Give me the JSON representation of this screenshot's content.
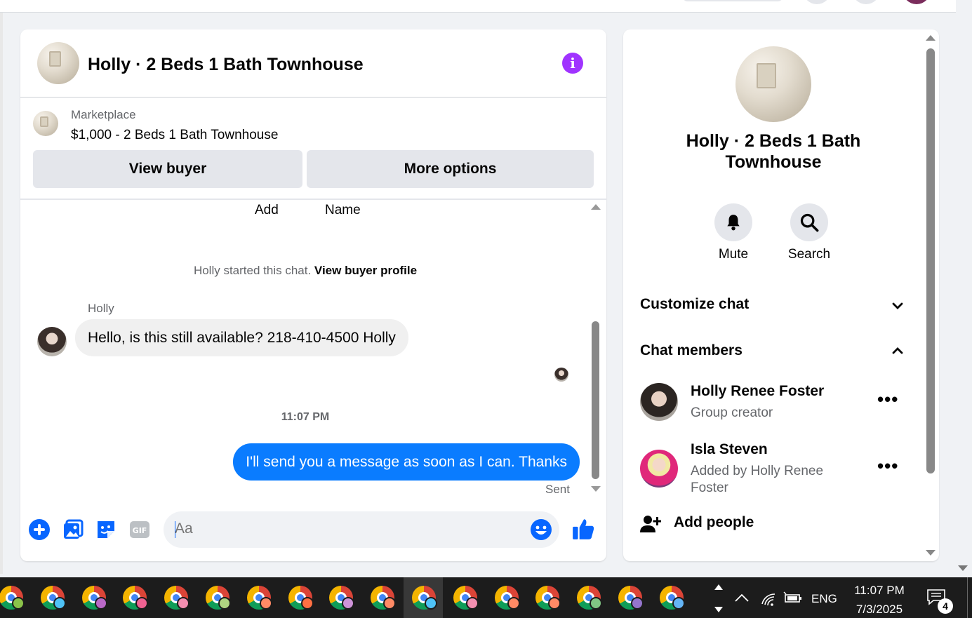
{
  "chat": {
    "title": "Holly · 2 Beds 1 Bath Townhouse",
    "marketplace_label": "Marketplace",
    "listing": "$1,000 - 2 Beds 1 Bath Townhouse",
    "view_buyer": "View buyer",
    "more_options": "More options",
    "add_label": "Add",
    "name_label": "Name",
    "started_text": "Holly started this chat. ",
    "view_profile": "View buyer profile",
    "sender_name": "Holly",
    "incoming_message": "Hello, is this still available? 218-410-4500 Holly",
    "timestamp": "11:07 PM",
    "outgoing_message": "I'll send you a message as soon as I can. Thanks",
    "status": "Sent",
    "composer_placeholder": "Aa",
    "accent_color": "#0a7cff"
  },
  "info": {
    "title": "Holly · 2 Beds 1 Bath Townhouse",
    "mute": "Mute",
    "search": "Search",
    "customize": "Customize chat",
    "members_title": "Chat members",
    "members": [
      {
        "name": "Holly Renee Foster",
        "sub": "Group creator"
      },
      {
        "name": "Isla Steven",
        "sub": "Added by Holly Renee Foster"
      }
    ],
    "add_people": "Add people"
  },
  "taskbar": {
    "lang": "ENG",
    "time": "11:07 PM",
    "date": "7/3/2025",
    "notifications": "4",
    "app_icons": [
      "chrome-icon"
    ],
    "profile_colors": [
      "#8bc34a",
      "#4fc3f7",
      "#ba68c8",
      "#f06292",
      "#f48fb1",
      "#aed581",
      "#ff8a65",
      "#ff7043",
      "#ce93d8",
      "#ff8a65",
      "#4fc3f7",
      "#f48fb1",
      "#ff8a65",
      "#ff8a65",
      "#81c784",
      "#9575cd",
      "#64b5f6"
    ]
  }
}
